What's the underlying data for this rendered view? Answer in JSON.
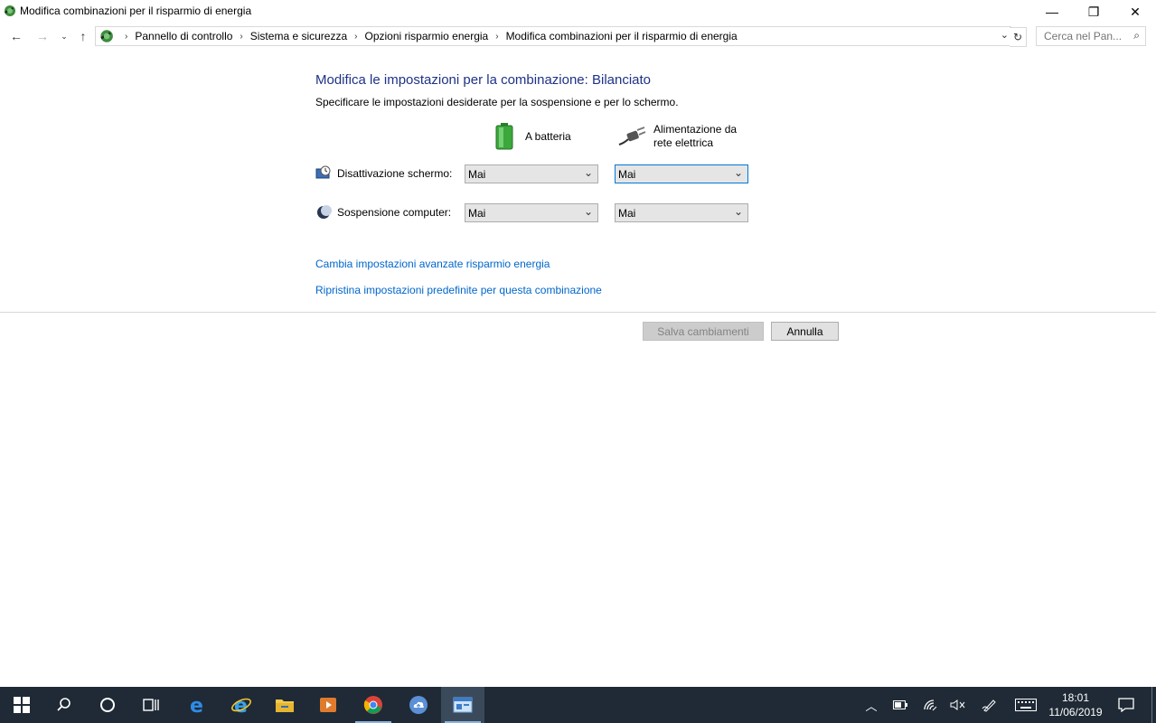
{
  "window": {
    "title": "Modifica combinazioni per il risparmio di energia",
    "minimize_label": "—",
    "maximize_label": "❐",
    "close_label": "✕"
  },
  "nav": {
    "breadcrumbs": [
      "Pannello di controllo",
      "Sistema e sicurezza",
      "Opzioni risparmio energia",
      "Modifica combinazioni per il risparmio di energia"
    ],
    "search_placeholder": "Cerca nel Pan..."
  },
  "content": {
    "heading": "Modifica le impostazioni per la combinazione: Bilanciato",
    "subtext": "Specificare le impostazioni desiderate per la sospensione e per lo schermo.",
    "col_battery": "A batteria",
    "col_ac": "Alimentazione da rete elettrica",
    "display_label": "Disattivazione schermo:",
    "sleep_label": "Sospensione computer:",
    "display_battery": "Mai",
    "display_ac": "Mai",
    "sleep_battery": "Mai",
    "sleep_ac": "Mai",
    "link_advanced": "Cambia impostazioni avanzate risparmio energia",
    "link_restore": "Ripristina impostazioni predefinite per questa combinazione",
    "save_label": "Salva cambiamenti",
    "cancel_label": "Annulla"
  },
  "taskbar": {
    "time": "18:01",
    "date": "11/06/2019"
  },
  "colors": {
    "heading": "#1e3287",
    "link": "#0066cc",
    "taskbar": "#1f2a36"
  }
}
